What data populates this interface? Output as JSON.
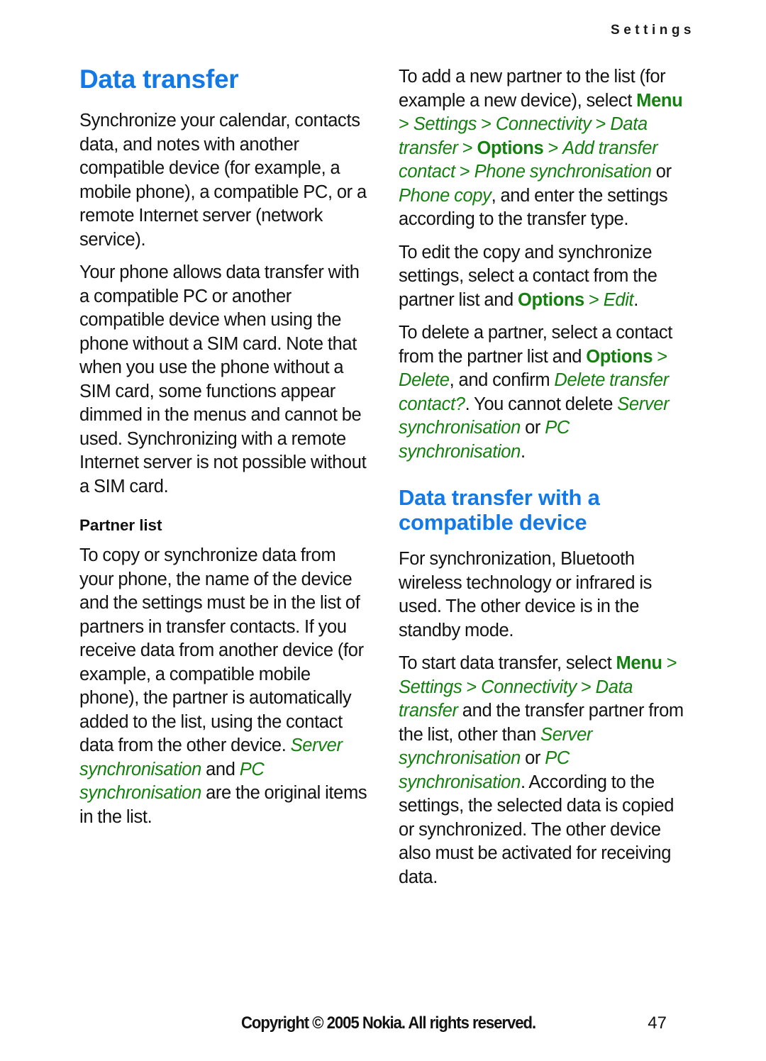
{
  "header": {
    "running_head": "Settings"
  },
  "left_column": {
    "chapter_title": "Data transfer",
    "paragraph_1": "Synchronize your calendar, contacts data, and notes with another compatible device (for example, a mobile phone), a compatible PC, or a remote Internet server (network service).",
    "paragraph_2": "Your phone allows data transfer with a compatible PC or another compatible device when using the phone without a SIM card. Note that when you use the phone without a SIM card, some functions appear dimmed in the menus and cannot be used. Synchronizing with a remote Internet server is not possible without a SIM card.",
    "sub_title": "Partner list",
    "paragraph_3": {
      "part_1": "To copy or synchronize data from your phone, the name of the device and the settings must be in the list of partners in transfer contacts. If you receive data from another device (for example, a compatible mobile phone), the partner is automatically added to the list, using the contact data from the other device. ",
      "ui_1": "Server synchronisation",
      "part_2": " and ",
      "ui_2": "PC synchronisation",
      "part_3": " are the original items in the list."
    }
  },
  "right_column": {
    "paragraph_1": {
      "part_1": "To add a new partner to the list (for example a new device), select ",
      "ui_menu": "Menu",
      "sep_1": " > ",
      "ui_settings": "Settings",
      "sep_2": " > ",
      "ui_connectivity": "Connectivity",
      "sep_3": " > ",
      "ui_data_transfer": "Data transfer",
      "sep_4": " > ",
      "ui_options": "Options",
      "sep_5": " > ",
      "ui_add_transfer_contact": "Add transfer contact",
      "sep_6": " > ",
      "ui_phone_sync": "Phone synchronisation",
      "part_2": " or ",
      "ui_phone_copy": "Phone copy",
      "part_3": ", and enter the settings according to the transfer type."
    },
    "paragraph_2": {
      "part_1": "To edit the copy and synchronize settings, select a contact from the partner list and ",
      "ui_options": "Options",
      "sep_1": " > ",
      "ui_edit": "Edit",
      "part_2": "."
    },
    "paragraph_3": {
      "part_1": "To delete a partner, select a contact from the partner list and ",
      "ui_options": "Options",
      "sep_1": " > ",
      "ui_delete": "Delete",
      "part_2": ", and confirm ",
      "ui_delete_transfer_contact": "Delete transfer contact?",
      "part_3": ". You cannot delete ",
      "ui_server_sync": "Server synchronisation",
      "part_4": " or ",
      "ui_pc_sync": "PC synchronisation",
      "part_5": "."
    },
    "section_title": "Data transfer with a compatible device",
    "paragraph_4": "For synchronization, Bluetooth wireless technology or infrared is used. The other device is in the standby mode.",
    "paragraph_5": {
      "part_1": "To start data transfer, select ",
      "ui_menu": "Menu",
      "sep_1": " > ",
      "ui_settings": "Settings",
      "sep_2": " > ",
      "ui_connectivity": "Connectivity",
      "sep_3": " > ",
      "ui_data_transfer": "Data transfer",
      "part_2": " and the transfer partner from the list, other than ",
      "ui_server_sync": "Server synchronisation",
      "part_3": " or ",
      "ui_pc_sync": "PC synchronisation",
      "part_4": ". According to the settings, the selected data is copied or synchronized. The other device also must be activated for receiving data."
    }
  },
  "footer": {
    "copyright": "Copyright © 2005 Nokia. All rights reserved.",
    "page_number": "47"
  },
  "colors": {
    "heading_blue": "#1379e6",
    "ui_green": "#13800f",
    "body_black": "#121212"
  }
}
